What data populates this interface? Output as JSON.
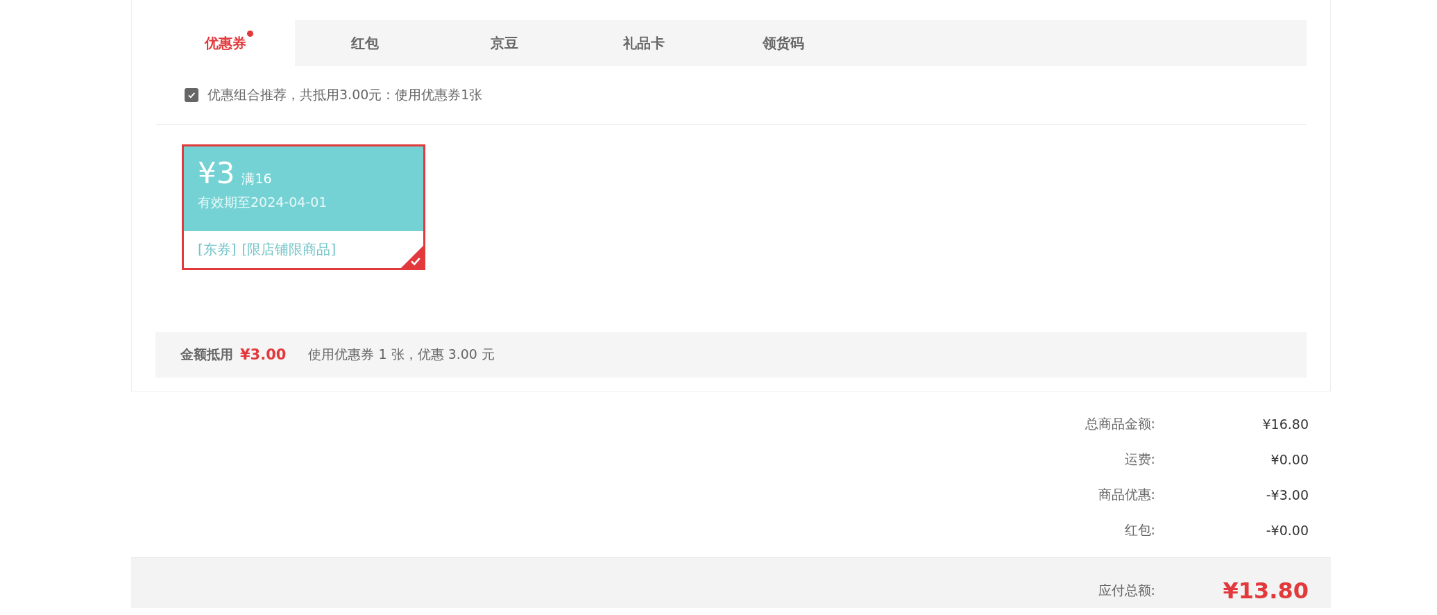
{
  "tabs": [
    {
      "label": "优惠券",
      "selected": true,
      "dot": true
    },
    {
      "label": "红包",
      "selected": false,
      "dot": false
    },
    {
      "label": "京豆",
      "selected": false,
      "dot": false
    },
    {
      "label": "礼品卡",
      "selected": false,
      "dot": false
    },
    {
      "label": "领货码",
      "selected": false,
      "dot": false
    }
  ],
  "recommend": {
    "label": "优惠组合推荐，共抵用3.00元：使用优惠券1张",
    "checked": true
  },
  "coupons": [
    {
      "amount": "¥3",
      "condition": "满16",
      "validity": "有效期至2024-04-01",
      "tags": [
        "[东券]",
        "[限店铺限商品]"
      ],
      "selected": true
    }
  ],
  "deduction_bar": {
    "label": "金额抵用",
    "amount": "¥3.00",
    "note": "使用优惠券 1 张，优惠 3.00 元"
  },
  "totals": [
    {
      "label": "总商品金额:",
      "value": "¥16.80"
    },
    {
      "label": "运费:",
      "value": "¥0.00"
    },
    {
      "label": "商品优惠:",
      "value": "-¥3.00"
    },
    {
      "label": "红包:",
      "value": "-¥0.00"
    }
  ],
  "grand_total": {
    "label": "应付总额:",
    "value": "¥13.80"
  }
}
